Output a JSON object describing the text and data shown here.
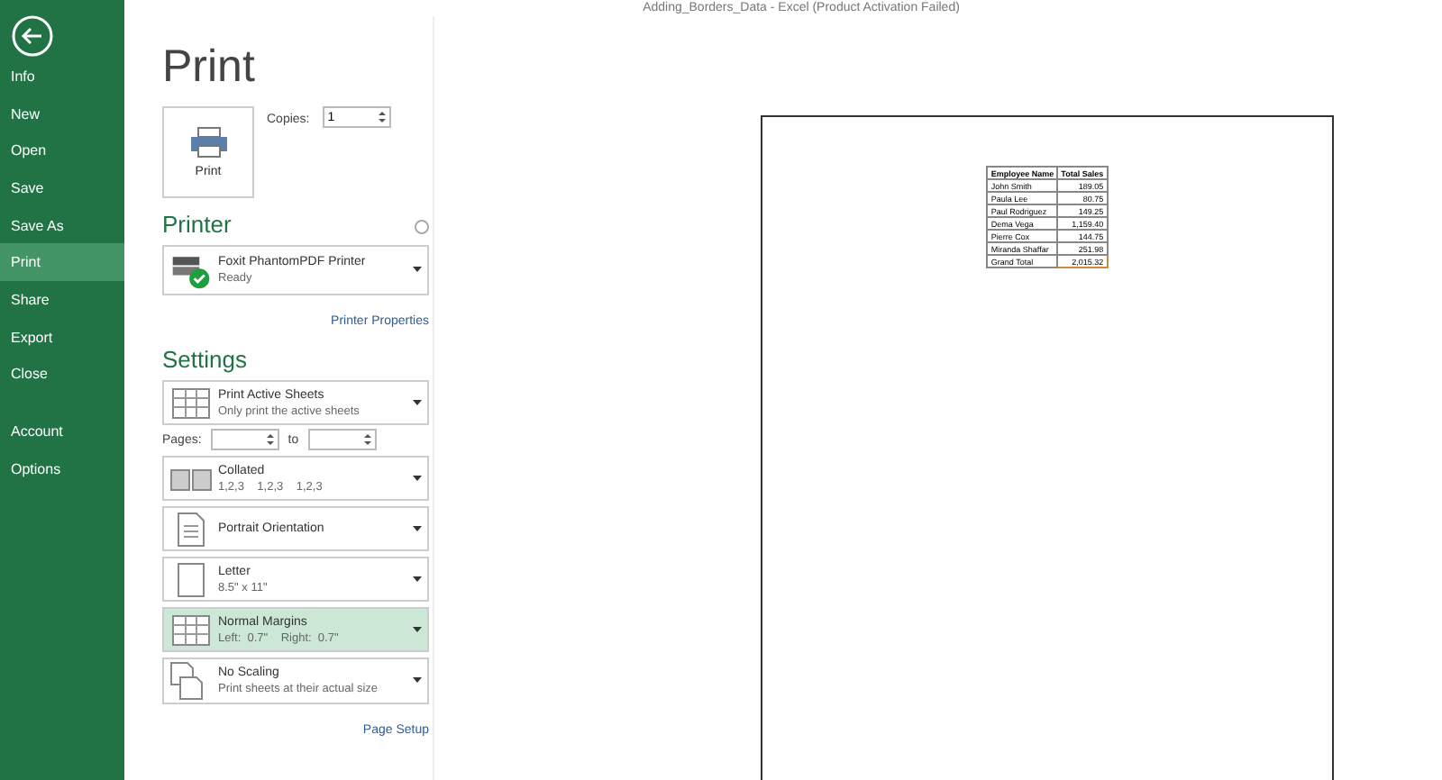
{
  "window": {
    "title": "Adding_Borders_Data - Excel (Product Activation Failed)"
  },
  "sidebar": {
    "items": [
      {
        "label": "Info",
        "selected": false
      },
      {
        "label": "New",
        "selected": false
      },
      {
        "label": "Open",
        "selected": false
      },
      {
        "label": "Save",
        "selected": false
      },
      {
        "label": "Save As",
        "selected": false
      },
      {
        "label": "Print",
        "selected": true
      },
      {
        "label": "Share",
        "selected": false
      },
      {
        "label": "Export",
        "selected": false
      },
      {
        "label": "Close",
        "selected": false
      }
    ],
    "bottom_items": [
      {
        "label": "Account",
        "selected": false
      },
      {
        "label": "Options",
        "selected": false
      }
    ]
  },
  "heading": "Print",
  "print_button": "Print",
  "copies": {
    "label": "Copies:",
    "value": "1"
  },
  "printer": {
    "heading": "Printer",
    "name": "Foxit PhantomPDF Printer",
    "status": "Ready",
    "link": "Printer Properties"
  },
  "settings": {
    "heading": "Settings",
    "pages_label": "Pages:",
    "to_label": "to",
    "link": "Page Setup",
    "options": [
      {
        "kind": "sheets",
        "title": "Print Active Sheets",
        "subtitle": "Only print the active sheets",
        "highlighted": false
      },
      {
        "kind": "pages"
      },
      {
        "kind": "collated",
        "title": "Collated",
        "subtitle": "1,2,3    1,2,3    1,2,3",
        "highlighted": false
      },
      {
        "kind": "orientation",
        "title": "Portrait Orientation",
        "highlighted": false
      },
      {
        "kind": "paper",
        "title": "Letter",
        "subtitle": "8.5\" x 11\"",
        "highlighted": false
      },
      {
        "kind": "margins",
        "title": "Normal Margins",
        "subtitle": "Left:  0.7\"    Right:  0.7\"",
        "highlighted": true
      },
      {
        "kind": "scaling",
        "title": "No Scaling",
        "subtitle": "Print sheets at their actual size",
        "highlighted": false
      }
    ]
  },
  "preview": {
    "columns": [
      "Employee Name",
      "Total Sales"
    ],
    "rows": [
      [
        "John Smith",
        "189.05"
      ],
      [
        "Paula Lee",
        "80.75"
      ],
      [
        "Paul Rodriguez",
        "149.25"
      ],
      [
        "Dema Vega",
        "1,159.40"
      ],
      [
        "Pierre Cox",
        "144.75"
      ],
      [
        "Miranda Shaffar",
        "251.98"
      ],
      [
        "Grand Total",
        "2,015.32"
      ]
    ]
  }
}
